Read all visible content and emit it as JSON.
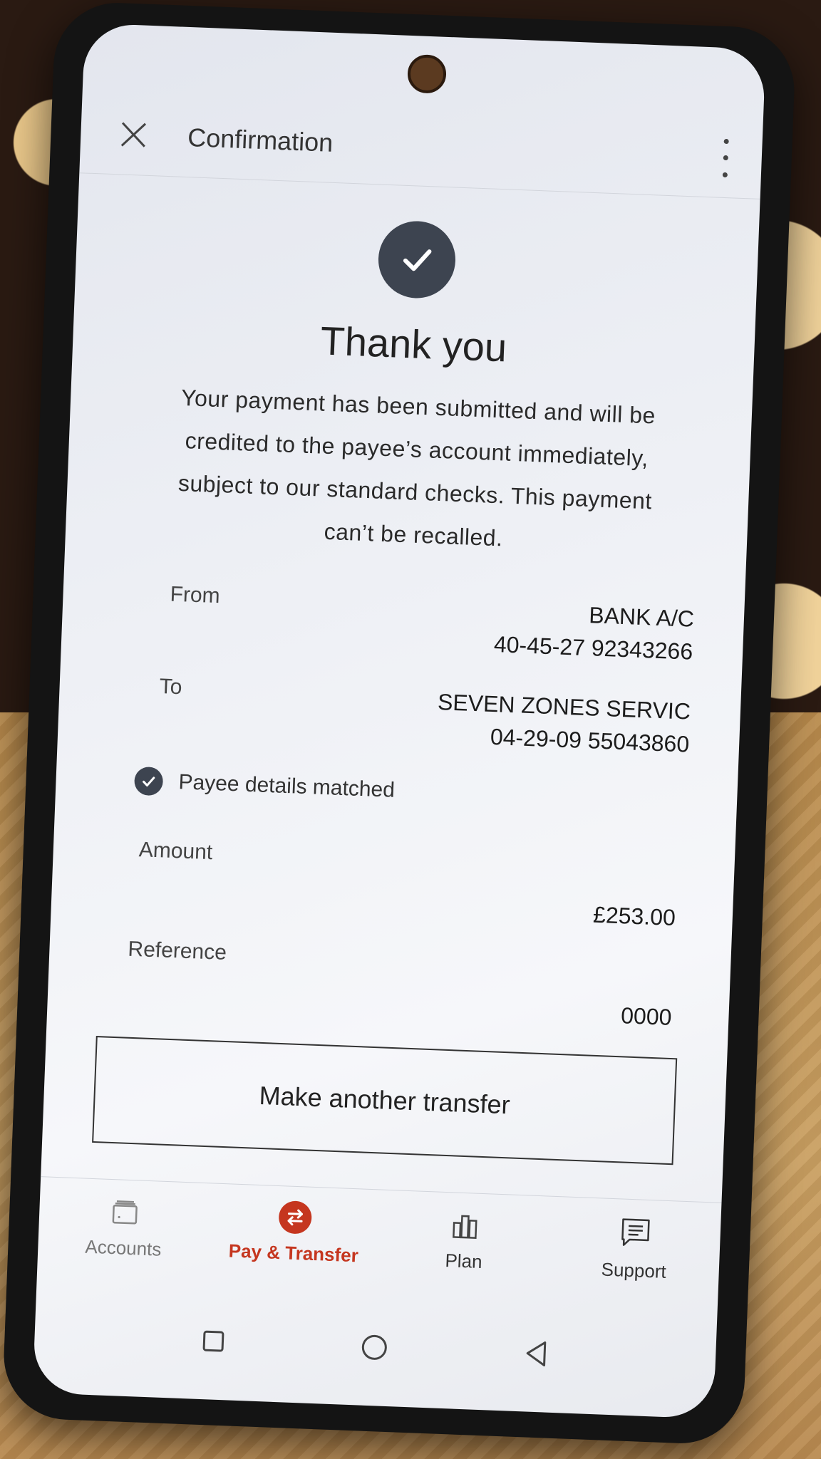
{
  "header": {
    "title": "Confirmation"
  },
  "confirmation": {
    "heading": "Thank you",
    "message": "Your payment has been submitted and will be credited to the payee’s account immediately, subject to our standard checks. This payment can’t be recalled."
  },
  "details": {
    "from_label": "From",
    "from_name": "BANK A/C",
    "from_account": "40-45-27 92343266",
    "to_label": "To",
    "to_name": "SEVEN ZONES SERVIC",
    "to_account": "04-29-09 55043860",
    "payee_status": "Payee details matched",
    "amount_label": "Amount",
    "amount_value": "£253.00",
    "reference_label": "Reference",
    "reference_value": "0000"
  },
  "actions": {
    "make_another": "Make another transfer"
  },
  "nav": {
    "items": [
      {
        "label": "Accounts",
        "icon": "wallet-icon",
        "active": false
      },
      {
        "label": "Pay & Transfer",
        "icon": "transfer-icon",
        "active": true
      },
      {
        "label": "Plan",
        "icon": "bar-chart-icon",
        "active": false
      },
      {
        "label": "Support",
        "icon": "chat-icon",
        "active": false
      }
    ]
  },
  "colors": {
    "accent": "#c5361f",
    "check_circle": "#3d4450",
    "text": "#222222"
  }
}
